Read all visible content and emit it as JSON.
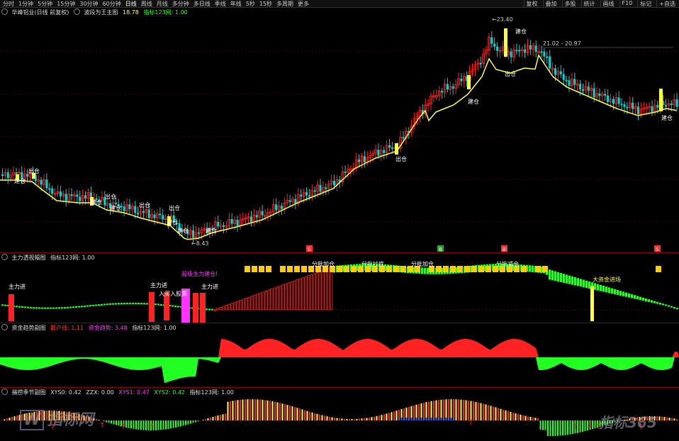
{
  "toolbar": {
    "periods": [
      "分时",
      "1分钟",
      "5分钟",
      "15分钟",
      "30分钟",
      "60分钟",
      "日线",
      "周线",
      "月线",
      "多分钟",
      "多日线",
      "季线",
      "年线",
      "5秒",
      "15秒",
      "多周期",
      "更多"
    ],
    "active": "日线",
    "right": [
      "复权",
      "叠加",
      "多股",
      "统计",
      "画线",
      "F10",
      "标记",
      "+自选"
    ]
  },
  "main": {
    "title": "华峰铝业(日线 前复权)",
    "indicator": "波段为王主图",
    "value1": "18.78",
    "value2": "指标123网: 1.00",
    "high_label": "23.40",
    "low_label": "8.43",
    "range_label": "21.02 - 20.97",
    "markers": [
      "建仓",
      "出仓",
      "建仓",
      "出仓",
      "建仓",
      "出仓",
      "建仓",
      "出仓",
      "建仓",
      "出仓",
      "建仓",
      "出仓",
      "建仓",
      "建仓",
      "建仓"
    ],
    "bottom_marks": [
      "S",
      "B",
      "B",
      "S"
    ]
  },
  "p2": {
    "title": "主力透视幅图",
    "value": "指标123网: 1.00",
    "labels": [
      "主力进",
      "主力进",
      "入买入股票",
      "超级主力建仓!",
      "主力进",
      "分批加仓",
      "分批抄底",
      "分批加仓",
      "分批减仓",
      "大资金进场"
    ]
  },
  "p3": {
    "title": "资金趋势副图",
    "k1": "散户线: 1.11",
    "k2": "资金趋势: 3.48",
    "k3": "指标123网: 1.00"
  },
  "p4": {
    "title": "捕捞季节副图",
    "k1": "XYS0: 0.42",
    "k2": "ZZX: 0.00",
    "k3": "XYS1: 0.47",
    "k4": "XYS2: 0.42",
    "k5": "指标123网: 1.00"
  },
  "watermarks": [
    "指标网",
    "指标365"
  ],
  "colors": {
    "up": "#ff2222",
    "down": "#00d8d8",
    "ma": "#ffff33",
    "green": "#22ff22",
    "magenta": "#ff33ff"
  }
}
